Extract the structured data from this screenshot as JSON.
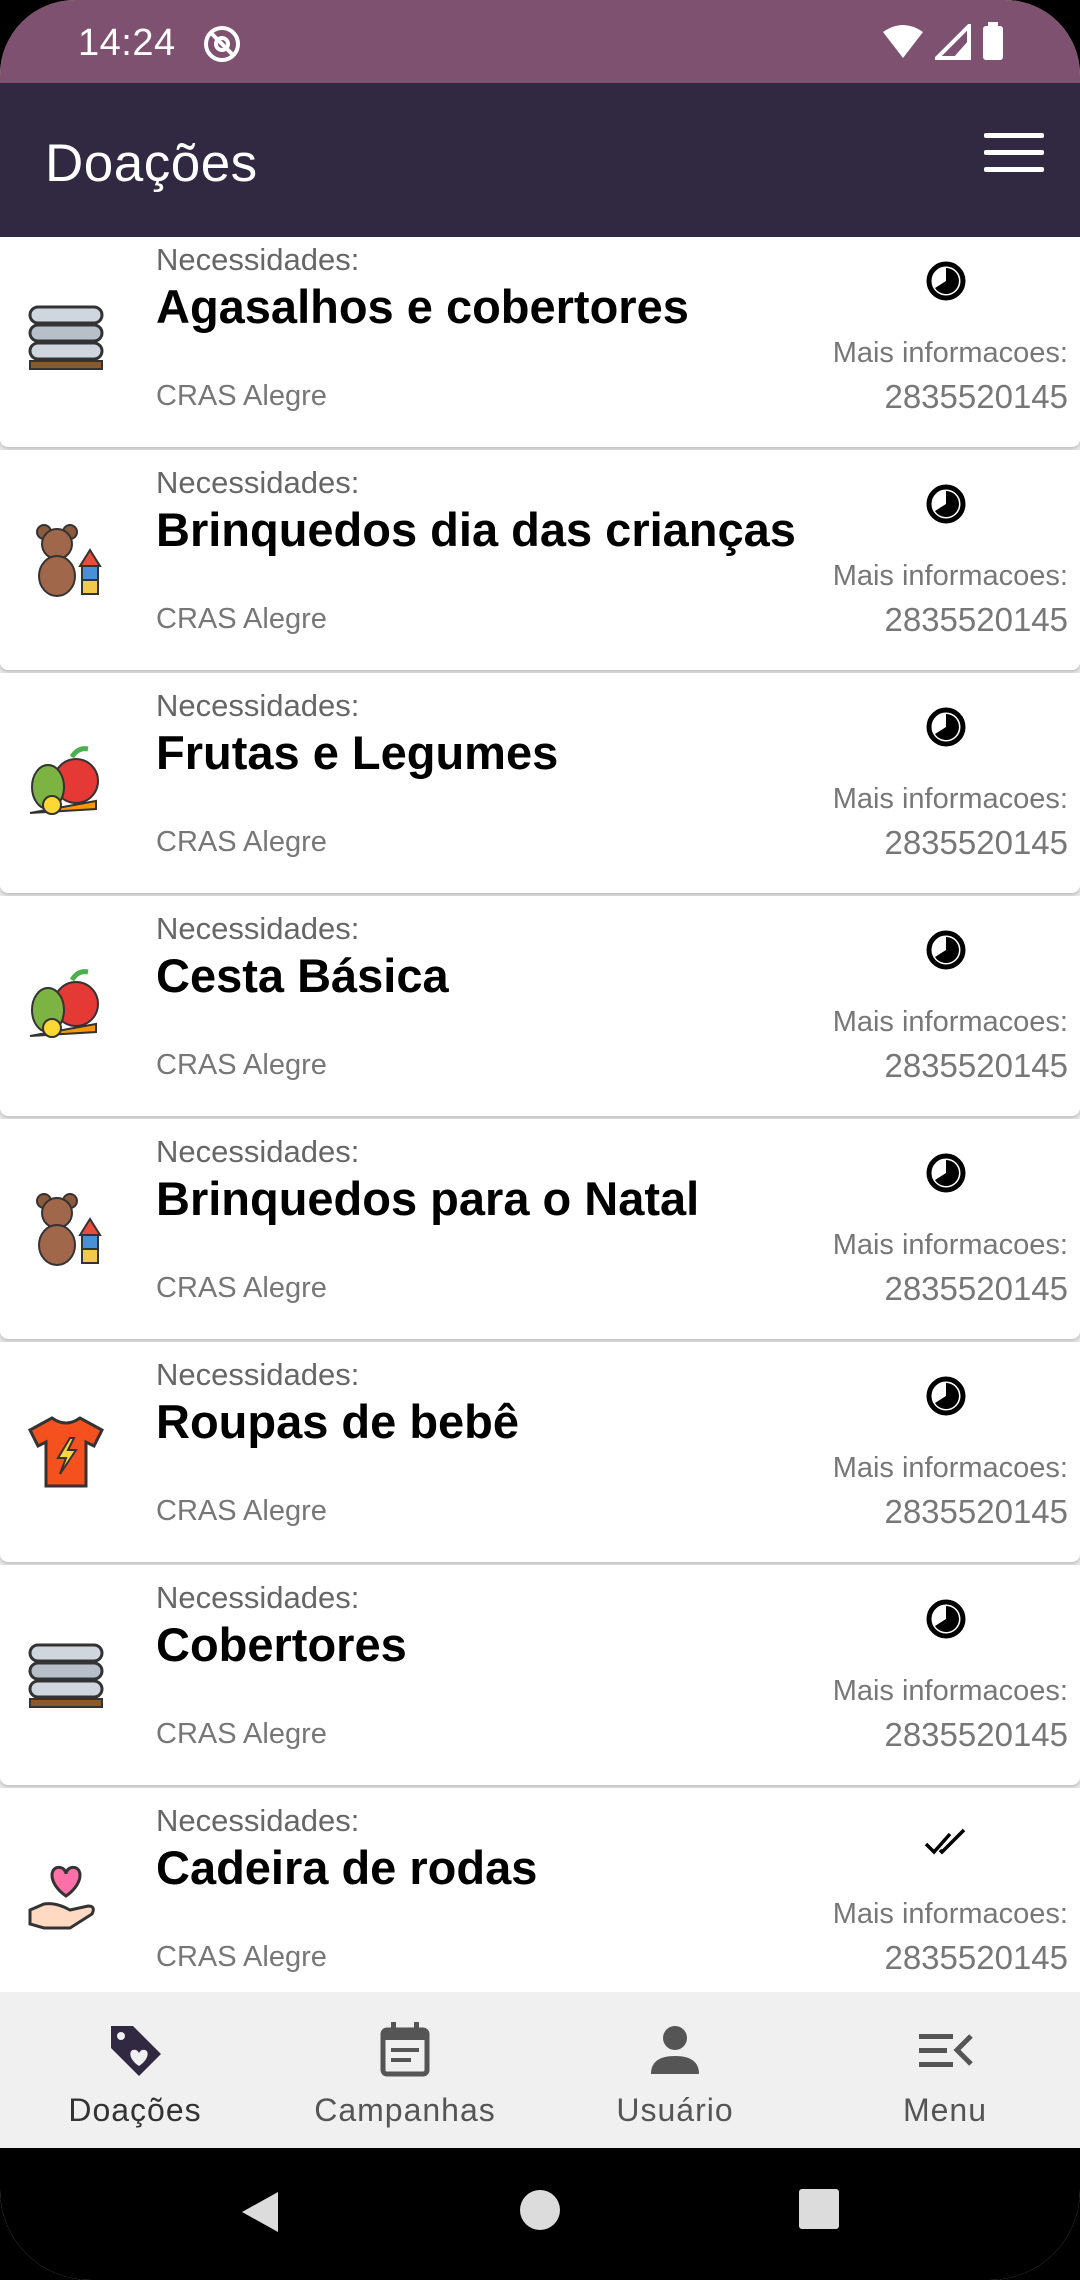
{
  "status_bar": {
    "time": "14:24"
  },
  "app_bar": {
    "title": "Doações"
  },
  "cards": [
    {
      "caption": "Necessidades:",
      "title": "Agasalhos e cobertores",
      "org": "CRAS Alegre",
      "more": "Mais informacoes:",
      "phone": "2835520145",
      "icon": "stacked-blankets-icon",
      "status": "in-progress-icon"
    },
    {
      "caption": "Necessidades:",
      "title": "Brinquedos dia das crianças",
      "org": "CRAS Alegre",
      "more": "Mais informacoes:",
      "phone": "2835520145",
      "icon": "teddy-bear-icon",
      "status": "in-progress-icon"
    },
    {
      "caption": "Necessidades:",
      "title": "Frutas e Legumes",
      "org": "CRAS Alegre",
      "more": "Mais informacoes:",
      "phone": "2835520145",
      "icon": "fruits-vegetables-icon",
      "status": "in-progress-icon"
    },
    {
      "caption": "Necessidades:",
      "title": "Cesta Básica",
      "org": "CRAS Alegre",
      "more": "Mais informacoes:",
      "phone": "2835520145",
      "icon": "fruits-vegetables-icon",
      "status": "in-progress-icon"
    },
    {
      "caption": "Necessidades:",
      "title": "Brinquedos para o Natal",
      "org": "CRAS Alegre",
      "more": "Mais informacoes:",
      "phone": "2835520145",
      "icon": "teddy-bear-icon",
      "status": "in-progress-icon"
    },
    {
      "caption": "Necessidades:",
      "title": "Roupas de bebê",
      "org": "CRAS Alegre",
      "more": "Mais informacoes:",
      "phone": "2835520145",
      "icon": "tshirt-icon",
      "status": "in-progress-icon"
    },
    {
      "caption": "Necessidades:",
      "title": "Cobertores",
      "org": "CRAS Alegre",
      "more": "Mais informacoes:",
      "phone": "2835520145",
      "icon": "stacked-blankets-icon",
      "status": "in-progress-icon"
    },
    {
      "caption": "Necessidades:",
      "title": "Cadeira de rodas",
      "org": "CRAS Alegre",
      "more": "Mais informacoes:",
      "phone": "2835520145",
      "icon": "heart-hand-icon",
      "status": "double-check-icon"
    }
  ],
  "bottom_nav": [
    {
      "label": "Doações",
      "icon": "tag-heart-icon",
      "active": true
    },
    {
      "label": "Campanhas",
      "icon": "calendar-icon",
      "active": false
    },
    {
      "label": "Usuário",
      "icon": "person-icon",
      "active": false
    },
    {
      "label": "Menu",
      "icon": "menu-collapse-icon",
      "active": false
    }
  ],
  "colors": {
    "status_bar": "#7e5170",
    "app_bar": "#312841",
    "nav_bg": "#f1f0f1"
  }
}
